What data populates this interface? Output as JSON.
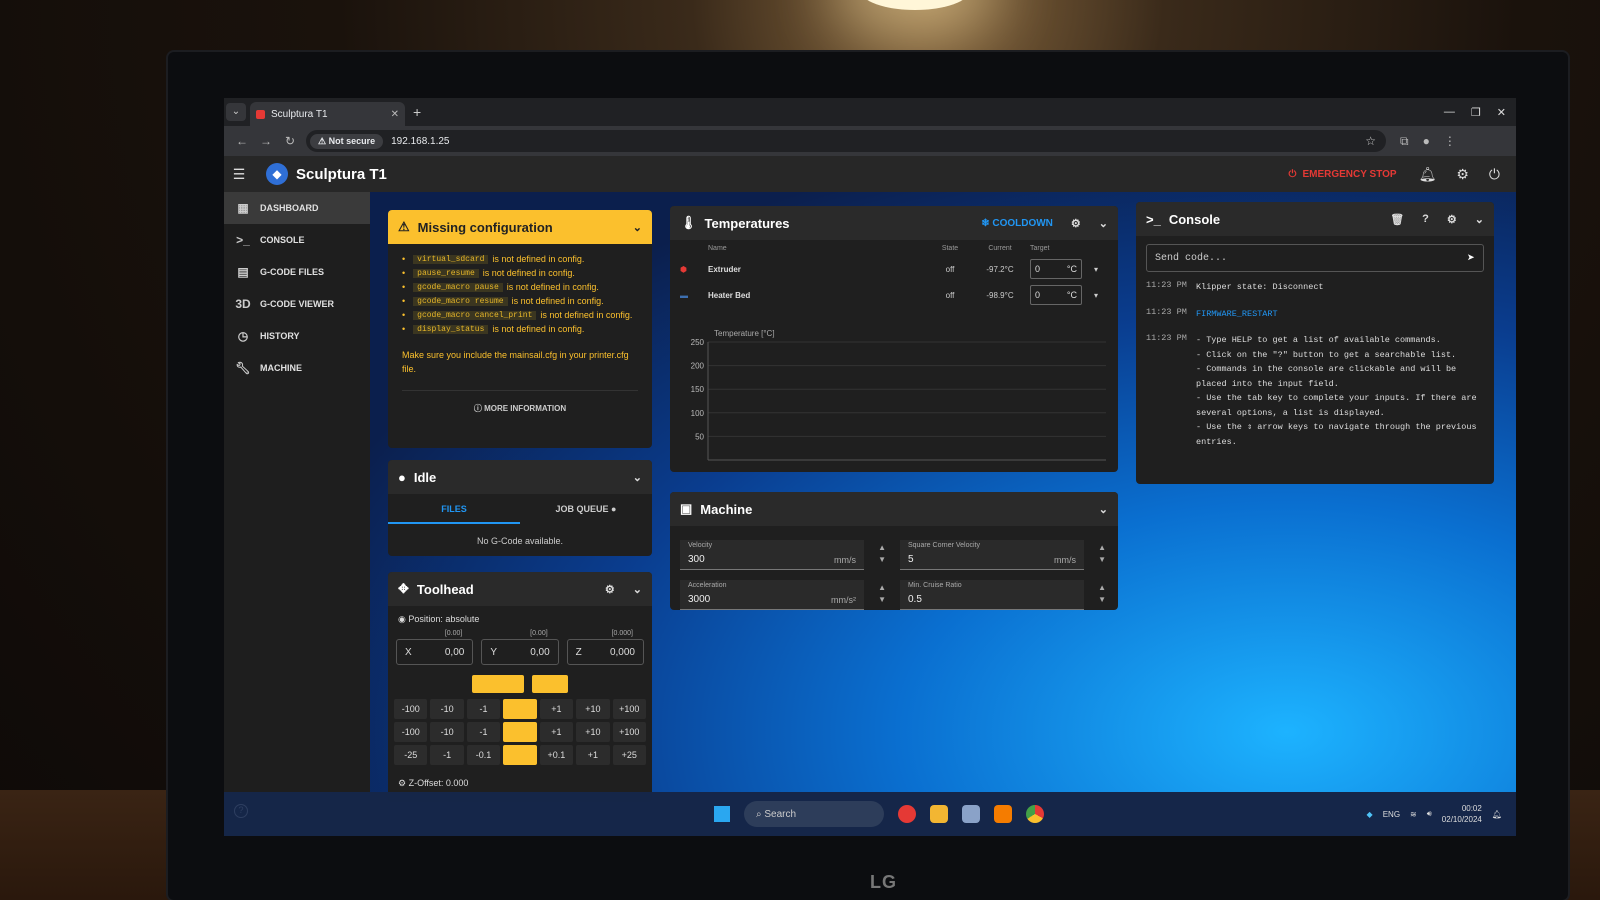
{
  "browser": {
    "tab_title": "Sculptura T1",
    "not_secure": "Not secure",
    "url": "192.168.1.25"
  },
  "app": {
    "title": "Sculptura T1",
    "emergency_stop": "EMERGENCY STOP"
  },
  "sidebar": {
    "items": [
      {
        "label": "DASHBOARD",
        "icon": "dashboard-icon"
      },
      {
        "label": "CONSOLE",
        "icon": "console-icon"
      },
      {
        "label": "G-CODE FILES",
        "icon": "file-icon"
      },
      {
        "label": "G-CODE VIEWER",
        "icon": "3d-icon"
      },
      {
        "label": "HISTORY",
        "icon": "history-icon"
      },
      {
        "label": "MACHINE",
        "icon": "wrench-icon"
      }
    ]
  },
  "warning": {
    "title": "Missing configuration",
    "items": [
      {
        "code": "virtual_sdcard",
        "text": "is not defined in config."
      },
      {
        "code": "pause_resume",
        "text": "is not defined in config."
      },
      {
        "code": "gcode_macro pause",
        "text": "is not defined in config."
      },
      {
        "code": "gcode_macro resume",
        "text": "is not defined in config."
      },
      {
        "code": "gcode_macro cancel_print",
        "text": "is not defined in config."
      },
      {
        "code": "display_status",
        "text": "is not defined in config."
      }
    ],
    "note": "Make sure you include the mainsail.cfg in your printer.cfg file.",
    "more_button": "MORE INFORMATION"
  },
  "status": {
    "title": "Idle",
    "tab_files": "FILES",
    "tab_queue": "JOB QUEUE",
    "empty": "No G-Code available."
  },
  "toolhead": {
    "title": "Toolhead",
    "position": "Position: absolute",
    "axes": [
      {
        "name": "X",
        "value": "0,00",
        "bracket": "[0.00]"
      },
      {
        "name": "Y",
        "value": "0,00",
        "bracket": "[0.00]"
      },
      {
        "name": "Z",
        "value": "0,000",
        "bracket": "[0.000]"
      }
    ],
    "jog_rows": [
      [
        "-100",
        "-10",
        "-1",
        "",
        "+1",
        "+10",
        "+100"
      ],
      [
        "-100",
        "-10",
        "-1",
        "",
        "+1",
        "+10",
        "+100"
      ],
      [
        "-25",
        "-1",
        "-0.1",
        "",
        "+0.1",
        "+1",
        "+25"
      ]
    ],
    "z_offset": "Z-Offset: 0.000"
  },
  "temperatures": {
    "title": "Temperatures",
    "cooldown": "COOLDOWN",
    "headers": {
      "name": "Name",
      "state": "State",
      "current": "Current",
      "target": "Target"
    },
    "rows": [
      {
        "name": "Extruder",
        "state": "off",
        "current": "-97.2°C",
        "target": "0",
        "unit": "°C"
      },
      {
        "name": "Heater Bed",
        "state": "off",
        "current": "-98.9°C",
        "target": "0",
        "unit": "°C"
      }
    ]
  },
  "chart_data": {
    "type": "line",
    "title": "",
    "ylabel": "Temperature [°C]",
    "ylim": [
      0,
      250
    ],
    "yticks": [
      50,
      100,
      150,
      200,
      250
    ],
    "series": []
  },
  "console": {
    "title": "Console",
    "placeholder": "Send code...",
    "lines": [
      {
        "time": "11:23 PM",
        "text": "Klipper state: Disconnect",
        "blue": false
      },
      {
        "time": "11:23 PM",
        "text": "FIRMWARE_RESTART",
        "blue": true
      },
      {
        "time": "11:23 PM",
        "text": "- Type HELP to get a list of available commands.\n- Click on the \"?\" button to get a searchable list.\n- Commands in the console are clickable and will be placed into the input field.\n- Use the tab key to complete your inputs. If there are several options, a list is displayed.\n- Use the ⇕ arrow keys to navigate through the previous entries.",
        "blue": false
      }
    ]
  },
  "machine": {
    "title": "Machine",
    "fields": [
      {
        "label": "Velocity",
        "value": "300",
        "unit": "mm/s"
      },
      {
        "label": "Square Corner Velocity",
        "value": "5",
        "unit": "mm/s"
      },
      {
        "label": "Acceleration",
        "value": "3000",
        "unit": "mm/s²"
      },
      {
        "label": "Min. Cruise Ratio",
        "value": "0.5",
        "unit": ""
      }
    ]
  },
  "taskbar": {
    "search": "Search",
    "lang": "ENG",
    "time": "00:02",
    "date": "02/10/2024"
  },
  "monitor_brand": "LG"
}
